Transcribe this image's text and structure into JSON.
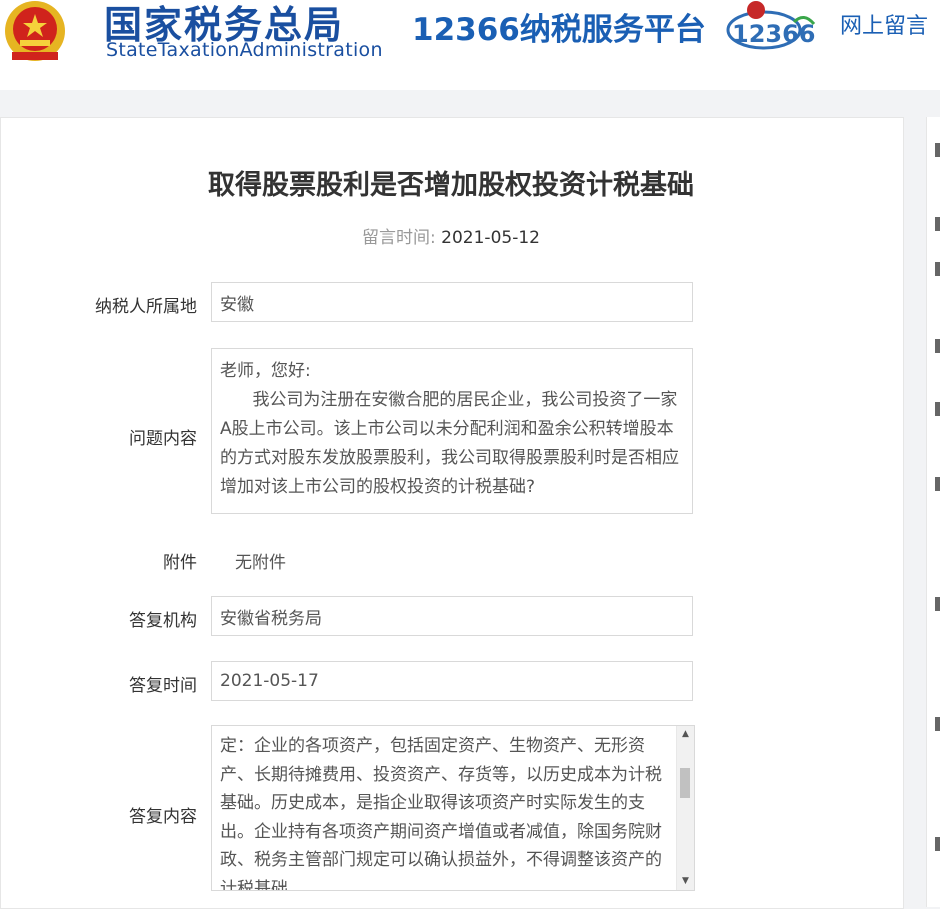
{
  "header": {
    "site_name": "国家税务总局",
    "site_name_en": "StateTaxationAdministration",
    "platform_name": "12366纳税服务平台",
    "logo_text": "12366",
    "top_link": "网上留言"
  },
  "article": {
    "title": "取得股票股利是否增加股权投资计税基础",
    "posted_label": "留言时间:",
    "posted_date": "2021-05-12"
  },
  "fields": {
    "region_label": "纳税人所属地",
    "region_value": "安徽",
    "question_label": "问题内容",
    "question_value": "老师，您好:\n      我公司为注册在安徽合肥的居民企业，我公司投资了一家A股上市公司。该上市公司以未分配利润和盈余公积转增股本的方式对股东发放股票股利，我公司取得股票股利时是否相应增加对该上市公司的股权投资的计税基础?",
    "attachment_label": "附件",
    "attachment_value": "无附件",
    "agency_label": "答复机构",
    "agency_value": "安徽省税务局",
    "reply_time_label": "答复时间",
    "reply_time_value": "2021-05-17",
    "reply_label": "答复内容",
    "reply_value": "定：企业的各项资产，包括固定资产、生物资产、无形资产、长期待摊费用、投资资产、存货等，以历史成本为计税基础。历史成本，是指企业取得该项资产时实际发生的支出。企业持有各项资产期间资产增值或者减值，除国务院财政、税务主管部门规定可以确认损益外，不得调整该资产的计税基础。"
  },
  "colors": {
    "brand_blue": "#1a4fa0",
    "label_gray": "#999999",
    "border": "#d9d9d9"
  },
  "icons": {
    "emblem": "national-emblem-icon",
    "logo": "12366-logo-icon",
    "scroll_up": "scroll-up-arrow-icon",
    "scroll_down": "scroll-down-arrow-icon"
  }
}
